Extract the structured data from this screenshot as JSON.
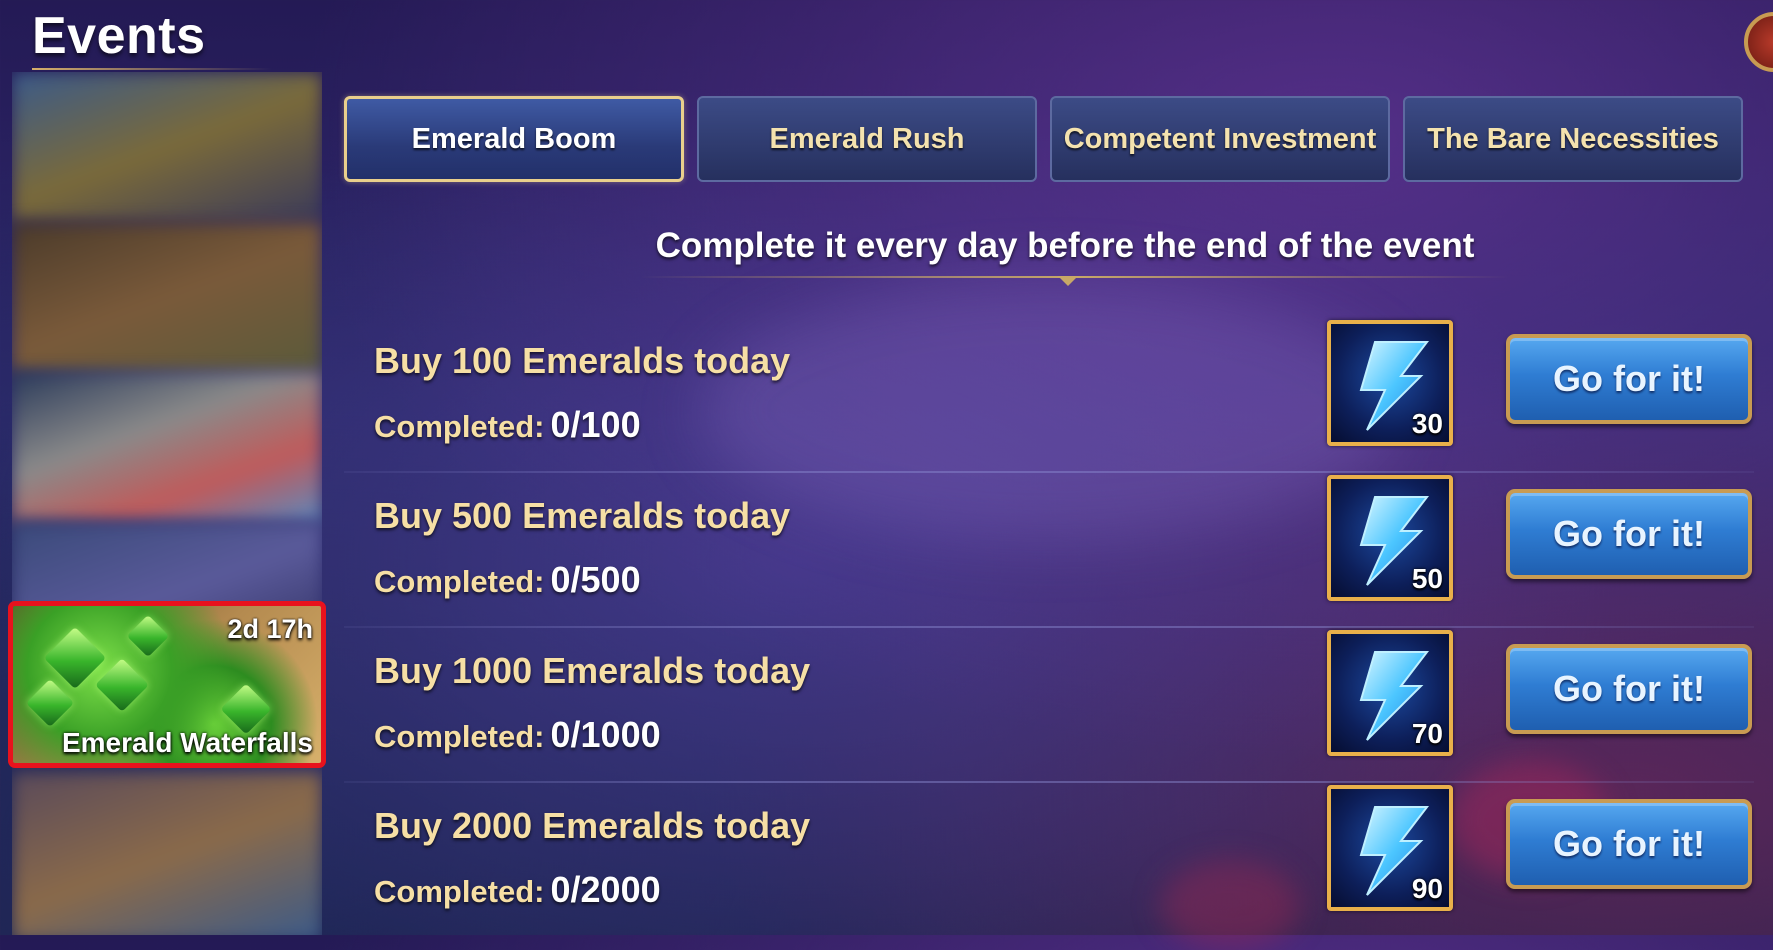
{
  "header": {
    "title": "Events"
  },
  "sidebar": {
    "selected_event": {
      "name": "Emerald Waterfalls",
      "timer": "2d 17h"
    }
  },
  "tabs": [
    {
      "label": "Emerald Boom",
      "active": true
    },
    {
      "label": "Emerald Rush",
      "active": false
    },
    {
      "label": "Competent Investment",
      "active": false
    },
    {
      "label": "The Bare Necessities",
      "active": false
    }
  ],
  "subheader": "Complete it every day before the end of the event",
  "tasks": [
    {
      "title": "Buy 100 Emeralds today",
      "progress_label": "Completed:",
      "progress": "0/100",
      "reward_icon": "energy-lightning-icon",
      "reward_count": "30",
      "button": "Go for it!"
    },
    {
      "title": "Buy 500 Emeralds today",
      "progress_label": "Completed:",
      "progress": "0/500",
      "reward_icon": "energy-lightning-icon",
      "reward_count": "50",
      "button": "Go for it!"
    },
    {
      "title": "Buy 1000 Emeralds today",
      "progress_label": "Completed:",
      "progress": "0/1000",
      "reward_icon": "energy-lightning-icon",
      "reward_count": "70",
      "button": "Go for it!"
    },
    {
      "title": "Buy 2000 Emeralds today",
      "progress_label": "Completed:",
      "progress": "0/2000",
      "reward_icon": "energy-lightning-icon",
      "reward_count": "90",
      "button": "Go for it!"
    }
  ],
  "colors": {
    "accent_gold": "#e9cf8c",
    "button_blue": "#2f7dd3",
    "highlight_red": "#e8121d"
  }
}
